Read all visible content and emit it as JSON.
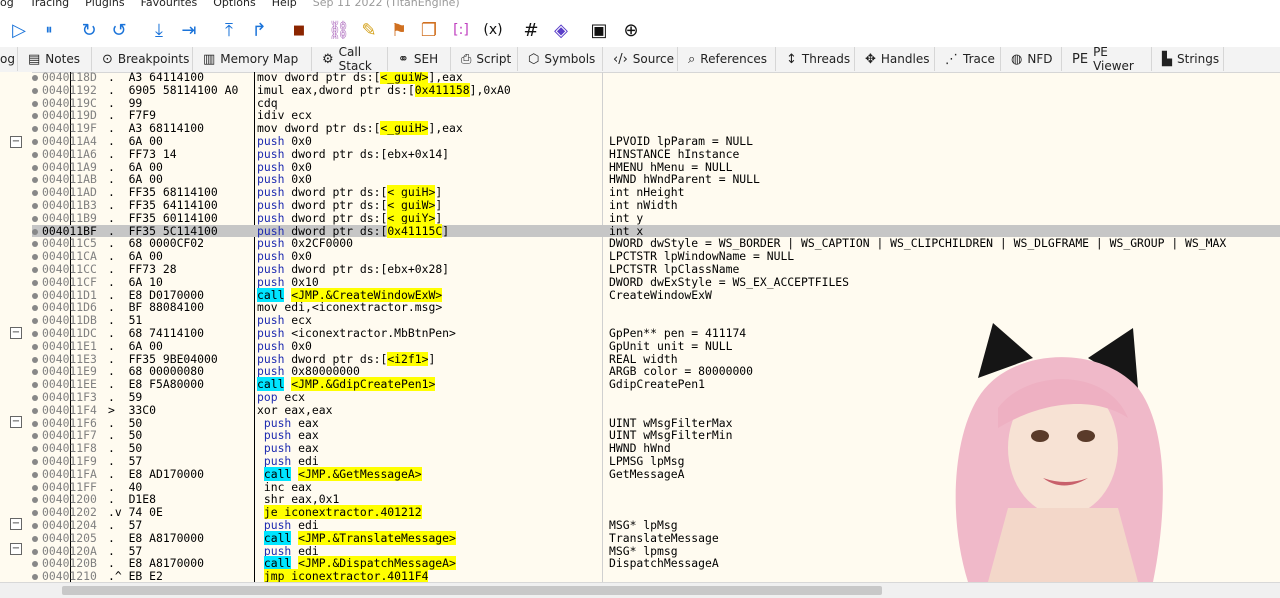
{
  "menubar": {
    "items": [
      "og",
      "Tracing",
      "Plugins",
      "Favourites",
      "Options",
      "Help"
    ],
    "date": "Sep 11 2022 (TitanEngine)"
  },
  "tabs": [
    {
      "label": "og",
      "icon": "log-icon"
    },
    {
      "label": "Notes",
      "icon": "notes-icon"
    },
    {
      "label": "Breakpoints",
      "icon": "breakpoint-icon"
    },
    {
      "label": "Memory Map",
      "icon": "memory-icon"
    },
    {
      "label": "Call Stack",
      "icon": "callstack-icon"
    },
    {
      "label": "SEH",
      "icon": "seh-icon"
    },
    {
      "label": "Script",
      "icon": "script-icon"
    },
    {
      "label": "Symbols",
      "icon": "symbols-icon"
    },
    {
      "label": "Source",
      "icon": "source-icon"
    },
    {
      "label": "References",
      "icon": "search-icon"
    },
    {
      "label": "Threads",
      "icon": "threads-icon"
    },
    {
      "label": "Handles",
      "icon": "handles-icon"
    },
    {
      "label": "Trace",
      "icon": "trace-icon"
    },
    {
      "label": "NFD",
      "icon": "nfd-icon"
    },
    {
      "label": "PE Viewer",
      "icon": "pe-icon"
    },
    {
      "label": "Strings",
      "icon": "strings-icon"
    }
  ],
  "rows": [
    {
      "addr": "0040118D",
      "bytes": ".  A3 64114100",
      "asm": "mov dword ptr ds:[<_guiW>],eax",
      "cmt": ""
    },
    {
      "addr": "00401192",
      "bytes": ".  6905 58114100 A0",
      "asm": "imul eax,dword ptr ds:[0x411158],0xA0",
      "cmt": ""
    },
    {
      "addr": "0040119C",
      "bytes": ".  99",
      "asm": "cdq",
      "cmt": ""
    },
    {
      "addr": "0040119D",
      "bytes": ".  F7F9",
      "asm": "idiv ecx",
      "cmt": ""
    },
    {
      "addr": "0040119F",
      "bytes": ".  A3 68114100",
      "asm": "mov dword ptr ds:[<_guiH>],eax",
      "cmt": ""
    },
    {
      "addr": "004011A4",
      "bytes": ".  6A 00",
      "asm": "push 0x0",
      "cmt": "LPVOID lpParam = NULL"
    },
    {
      "addr": "004011A6",
      "bytes": ".  FF73 14",
      "asm": "push dword ptr ds:[ebx+0x14]",
      "cmt": "HINSTANCE hInstance"
    },
    {
      "addr": "004011A9",
      "bytes": ".  6A 00",
      "asm": "push 0x0",
      "cmt": "HMENU hMenu = NULL"
    },
    {
      "addr": "004011AB",
      "bytes": ".  6A 00",
      "asm": "push 0x0",
      "cmt": "HWND hWndParent = NULL"
    },
    {
      "addr": "004011AD",
      "bytes": ".  FF35 68114100",
      "asm": "push dword ptr ds:[<_guiH>]",
      "cmt": "int nHeight"
    },
    {
      "addr": "004011B3",
      "bytes": ".  FF35 64114100",
      "asm": "push dword ptr ds:[<_guiW>]",
      "cmt": "int nWidth"
    },
    {
      "addr": "004011B9",
      "bytes": ".  FF35 60114100",
      "asm": "push dword ptr ds:[<_guiY>]",
      "cmt": "int y"
    },
    {
      "addr": "004011BF",
      "bytes": ".  FF35 5C114100",
      "asm": "push dword ptr ds:[0x41115C]",
      "cmt": "int x",
      "sel": true
    },
    {
      "addr": "004011C5",
      "bytes": ".  68 0000CF02",
      "asm": "push 0x2CF0000",
      "cmt": "DWORD dwStyle = WS_BORDER | WS_CAPTION | WS_CLIPCHILDREN | WS_DLGFRAME | WS_GROUP | WS_MAX"
    },
    {
      "addr": "004011CA",
      "bytes": ".  6A 00",
      "asm": "push 0x0",
      "cmt": "LPCTSTR lpWindowName = NULL"
    },
    {
      "addr": "004011CC",
      "bytes": ".  FF73 28",
      "asm": "push dword ptr ds:[ebx+0x28]",
      "cmt": "LPCTSTR lpClassName"
    },
    {
      "addr": "004011CF",
      "bytes": ".  6A 10",
      "asm": "push 0x10",
      "cmt": "DWORD dwExStyle = WS_EX_ACCEPTFILES"
    },
    {
      "addr": "004011D1",
      "bytes": ".  E8 D0170000",
      "asm": "call <JMP.&CreateWindowExW>",
      "cmt": "CreateWindowExW"
    },
    {
      "addr": "004011D6",
      "bytes": ".  BF 88084100",
      "asm": "mov edi,<iconextractor.msg>",
      "cmt": ""
    },
    {
      "addr": "004011DB",
      "bytes": ".  51",
      "asm": "push ecx",
      "cmt": ""
    },
    {
      "addr": "004011DC",
      "bytes": ".  68 74114100",
      "asm": "push <iconextractor.MbBtnPen>",
      "cmt": "GpPen** pen = 411174"
    },
    {
      "addr": "004011E1",
      "bytes": ".  6A 00",
      "asm": "push 0x0",
      "cmt": "GpUnit unit = NULL"
    },
    {
      "addr": "004011E3",
      "bytes": ".  FF35 9BE04000",
      "asm": "push dword ptr ds:[<i2f1>]",
      "cmt": "REAL width"
    },
    {
      "addr": "004011E9",
      "bytes": ".  68 00000080",
      "asm": "push 0x80000000",
      "cmt": "ARGB color = 80000000"
    },
    {
      "addr": "004011EE",
      "bytes": ".  E8 F5A80000",
      "asm": "call <JMP.&GdipCreatePen1>",
      "cmt": "GdipCreatePen1"
    },
    {
      "addr": "004011F3",
      "bytes": ".  59",
      "asm": "pop ecx",
      "cmt": ""
    },
    {
      "addr": "004011F4",
      "bytes": ">  33C0",
      "asm": "xor eax,eax",
      "cmt": ""
    },
    {
      "addr": "004011F6",
      "bytes": ".  50",
      "asm": " push eax",
      "cmt": "UINT wMsgFilterMax"
    },
    {
      "addr": "004011F7",
      "bytes": ".  50",
      "asm": " push eax",
      "cmt": "UINT wMsgFilterMin"
    },
    {
      "addr": "004011F8",
      "bytes": ".  50",
      "asm": " push eax",
      "cmt": "HWND hWnd"
    },
    {
      "addr": "004011F9",
      "bytes": ".  57",
      "asm": " push edi",
      "cmt": "LPMSG lpMsg"
    },
    {
      "addr": "004011FA",
      "bytes": ".  E8 AD170000",
      "asm": " call <JMP.&GetMessageA>",
      "cmt": "GetMessageA"
    },
    {
      "addr": "004011FF",
      "bytes": ".  40",
      "asm": " inc eax",
      "cmt": ""
    },
    {
      "addr": "00401200",
      "bytes": ".  D1E8",
      "asm": " shr eax,0x1",
      "cmt": ""
    },
    {
      "addr": "00401202",
      "bytes": ".v 74 0E",
      "asm": " je iconextractor.401212",
      "cmt": ""
    },
    {
      "addr": "00401204",
      "bytes": ".  57",
      "asm": " push edi",
      "cmt": "MSG* lpMsg"
    },
    {
      "addr": "00401205",
      "bytes": ".  E8 A8170000",
      "asm": " call <JMP.&TranslateMessage>",
      "cmt": "TranslateMessage"
    },
    {
      "addr": "0040120A",
      "bytes": ".  57",
      "asm": " push edi",
      "cmt": "MSG* lpmsg"
    },
    {
      "addr": "0040120B",
      "bytes": ".  E8 A8170000",
      "asm": " call <JMP.&DispatchMessageA>",
      "cmt": "DispatchMessageA"
    },
    {
      "addr": "00401210",
      "bytes": ".^ EB E2",
      "asm": " jmp iconextractor.4011F4",
      "cmt": ""
    }
  ],
  "colors": {
    "background": "#fffbf0",
    "selection": "#c6c6c6",
    "call_bg": "#00e5ff",
    "jmp_bg": "#ffff00"
  }
}
